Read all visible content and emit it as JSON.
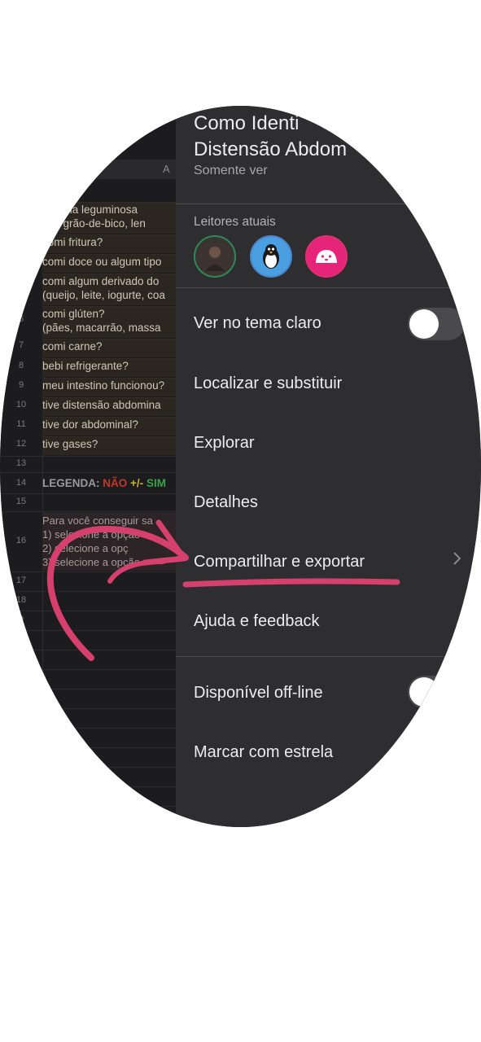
{
  "sheet": {
    "column_header": "A",
    "rows": [
      {
        "num": "",
        "text": "alguma leguminosa",
        "style": "tan"
      },
      {
        "num": "",
        "text": "jão, grão-de-bico, len",
        "style": "tan"
      },
      {
        "num": "",
        "text": "comi fritura?",
        "style": "tan"
      },
      {
        "num": "",
        "text": "comi doce ou algum tipo",
        "style": "tan"
      },
      {
        "num": "",
        "text": "comi algum derivado do",
        "style": "tan"
      },
      {
        "num": "",
        "text": "(queijo, leite, iogurte, coa",
        "style": "tan"
      },
      {
        "num": "6",
        "text": "comi glúten?",
        "style": "tan"
      },
      {
        "num": "",
        "text": "(pães, macarrão, massa",
        "style": "tan"
      },
      {
        "num": "7",
        "text": "comi carne?",
        "style": "tan"
      },
      {
        "num": "8",
        "text": "bebi refrigerante?",
        "style": "tan"
      },
      {
        "num": "9",
        "text": "meu intestino funcionou?",
        "style": "tan"
      },
      {
        "num": "10",
        "text": "tive distensão abdomina",
        "style": "tan"
      },
      {
        "num": "11",
        "text": "tive dor abdominal?",
        "style": "tan"
      },
      {
        "num": "12",
        "text": "tive gases?",
        "style": "tan"
      }
    ],
    "row13": "13",
    "row14": "14",
    "legend_label": "LEGENDA:",
    "legend_nao": "NÃO",
    "legend_mid": "+/-",
    "legend_sim": "SIM",
    "row15": "15",
    "row16": "16",
    "instructions": [
      "Para você conseguir sa",
      "1) selecione a opção",
      "2) selecione a opç",
      "3) selecione a opção"
    ],
    "row17": "17",
    "row18": "18",
    "row19": "9"
  },
  "panel": {
    "title_line1": "Como Identi",
    "title_line2": "Distensão Abdom",
    "subtitle": "Somente ver",
    "readers_label": "Leitores atuais",
    "menu": [
      {
        "label": "Ver no tema claro"
      },
      {
        "label": "Localizar e substituir"
      },
      {
        "label": "Explorar"
      },
      {
        "label": "Detalhes"
      },
      {
        "label": "Compartilhar e exportar"
      },
      {
        "label": "Ajuda e feedback"
      },
      {
        "label": "Disponível off-line"
      },
      {
        "label": "Marcar com estrela"
      }
    ],
    "toggles": {
      "theme_light": false,
      "offline": false
    }
  },
  "colors": {
    "panel_bg": "#2e2e30",
    "annotation": "#d6406f",
    "avatar_penguin": "#4a9fe0",
    "avatar_pink": "#e5247a"
  }
}
